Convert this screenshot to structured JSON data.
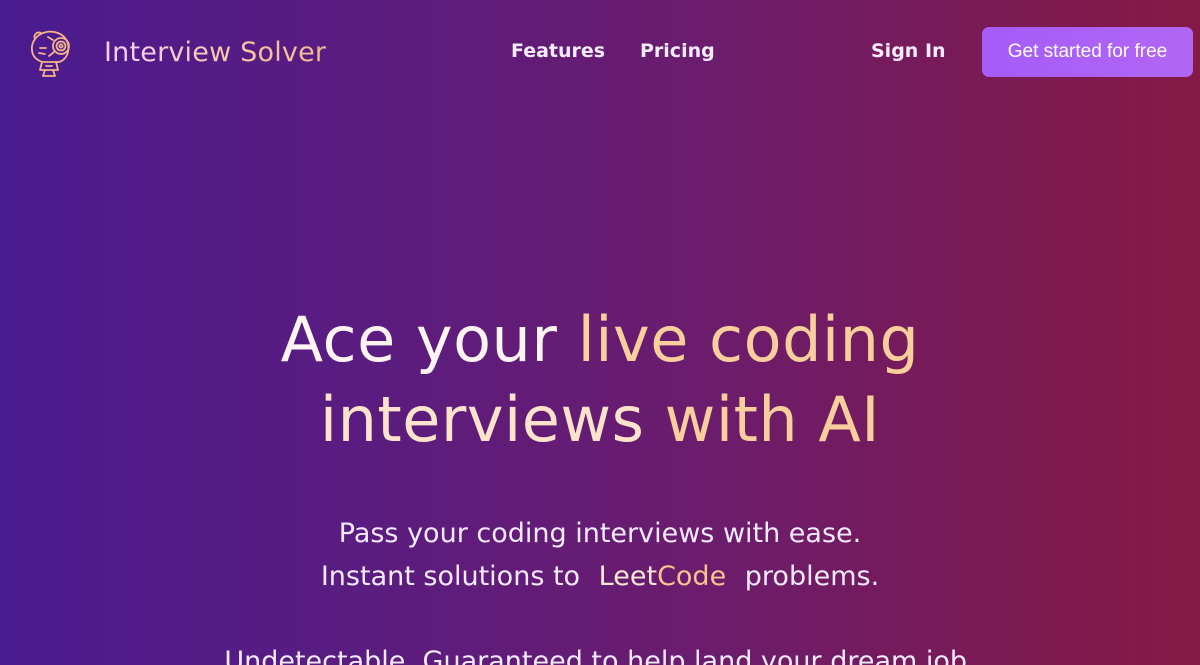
{
  "brand": {
    "name": "Interview Solver",
    "logo_icon": "robot-head-icon"
  },
  "nav": {
    "features": "Features",
    "pricing": "Pricing",
    "sign_in": "Sign In",
    "cta": "Get started for free"
  },
  "hero": {
    "title_line1_part1": "Ace your ",
    "title_line1_part2": "live coding",
    "title_line2_part1": "interviews ",
    "title_line2_part2": "with AI",
    "subtitle_line1": "Pass your coding interviews with ease.",
    "subtitle_line2_before": "Instant solutions to",
    "leetcode_leet": "Leet",
    "leetcode_code": "Code",
    "subtitle_line2_after": "problems.",
    "tagline": "Undetectable. Guaranteed to help land your dream job."
  },
  "colors": {
    "bg_left": "#4a1b8f",
    "bg_right": "#851a45",
    "accent": "#a55cf8",
    "peach": "#f8cf9c"
  }
}
